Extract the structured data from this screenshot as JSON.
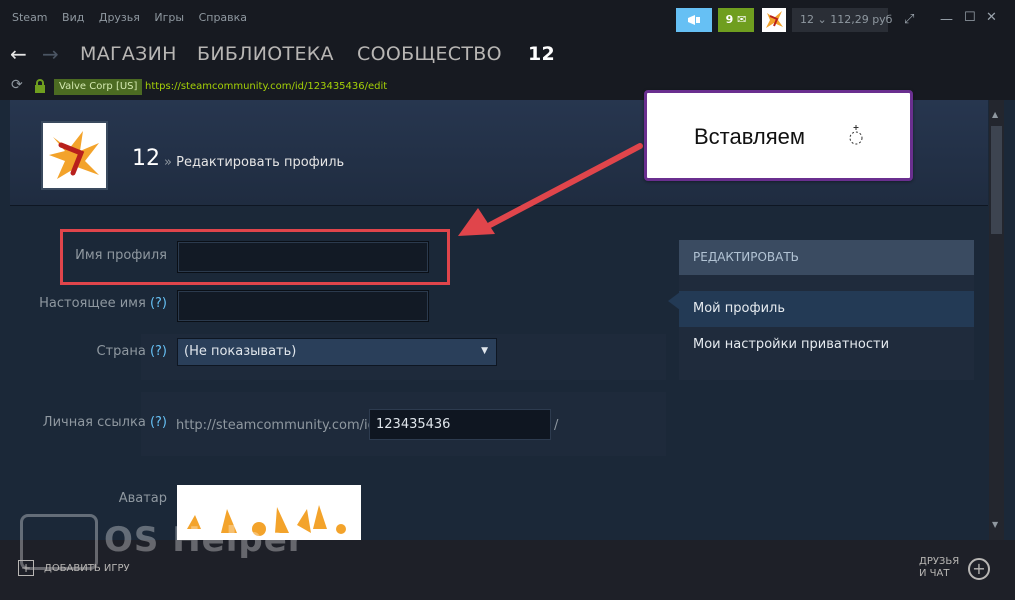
{
  "menu": [
    "Steam",
    "Вид",
    "Друзья",
    "Игры",
    "Справка"
  ],
  "topbar": {
    "notifications": "9",
    "account": "12 ⌄ 112,29 руб"
  },
  "nav": {
    "store": "МАГАЗИН",
    "library": "БИБЛИОТЕКА",
    "community": "СООБЩЕСТВО",
    "username": "12"
  },
  "urlbar": {
    "ev_label": "Valve Corp [US]",
    "url": "https://steamcommunity.com/id/123435436/edit"
  },
  "profile_header": {
    "name": "12",
    "separator": "»",
    "page": "Редактировать профиль"
  },
  "form": {
    "profile_name_label": "Имя профиля",
    "real_name_label": "Настоящее имя",
    "help_mark": "(?)",
    "country_label": "Страна",
    "country_value": "(Не показывать)",
    "custom_url_label": "Личная ссылка",
    "custom_url_prefix": "http://steamcommunity.com/id/",
    "custom_url_value": "123435436",
    "custom_url_suffix": "/",
    "avatar_label": "Аватар"
  },
  "panel": {
    "title": "РЕДАКТИРОВАТЬ",
    "item1": "Мой профиль",
    "item2": "Мои настройки приватности"
  },
  "callout": {
    "text": "Вставляем"
  },
  "watermark": {
    "text": "OS Helper"
  },
  "bottom": {
    "add_game": "ДОБАВИТЬ ИГРУ",
    "friends_line1": "ДРУЗЬЯ",
    "friends_line2": "И ЧАТ"
  },
  "colors": {
    "accent": "#66c0f4",
    "annotation": "#e0454b",
    "callout_border": "#6a2f8f"
  }
}
